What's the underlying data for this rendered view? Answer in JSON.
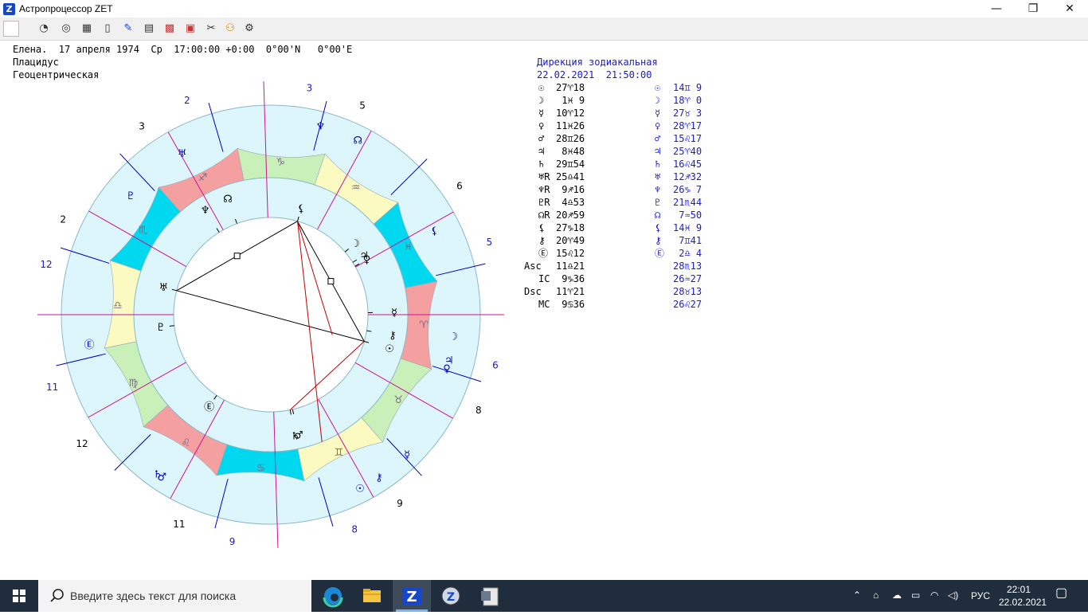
{
  "window": {
    "title": "Астропроцессор ZET",
    "minimize": "—",
    "restore": "❐",
    "close": "✕"
  },
  "header": {
    "line1": "Елена.  17 апреля 1974  Ср  17:00:00 +0:00  0°00'N   0°00'E",
    "line2": "Плацидус",
    "line3": "Геоцентрическая"
  },
  "direction": {
    "title": "Дирекция зодиакальная",
    "datetime": "22.02.2021  21:50:00",
    "rows": [
      {
        "l": "☉",
        "lv": "27♈18",
        "r": "☉",
        "rv": "14♊ 9"
      },
      {
        "l": "☽",
        "lv": " 1♓ 9",
        "r": "☽",
        "rv": "18♈ 0"
      },
      {
        "l": "☿",
        "lv": "10♈12",
        "r": "☿",
        "rv": "27♉ 3"
      },
      {
        "l": "♀",
        "lv": "11♓26",
        "r": "♀",
        "rv": "28♈17"
      },
      {
        "l": "♂",
        "lv": "28♊26",
        "r": "♂",
        "rv": "15♌17"
      },
      {
        "l": "♃",
        "lv": " 8♓48",
        "r": "♃",
        "rv": "25♈40"
      },
      {
        "l": "♄",
        "lv": "29♊54",
        "r": "♄",
        "rv": "16♌45"
      },
      {
        "l": "♅R",
        "lv": "25♎41",
        "r": "♅",
        "rv": "12♐32"
      },
      {
        "l": "♆R",
        "lv": " 9♐16",
        "r": "♆",
        "rv": "26♑ 7"
      },
      {
        "l": "♇R",
        "lv": " 4♎53",
        "r": "♇",
        "rv": "21♏44"
      },
      {
        "l": "☊R",
        "lv": "20♐59",
        "r": "☊",
        "rv": " 7♒50"
      },
      {
        "l": "⚸",
        "lv": "27♑18",
        "r": "⚸",
        "rv": "14♓ 9"
      },
      {
        "l": "⚷",
        "lv": "20♈49",
        "r": "⚷",
        "rv": " 7♊41"
      },
      {
        "l": "Ⓔ",
        "lv": "15♌12",
        "r": "Ⓔ",
        "rv": " 2♎ 4"
      },
      {
        "l": "Asc",
        "lv": "11♎21",
        "r": "",
        "rv": "28♏13"
      },
      {
        "l": "IC",
        "lv": " 9♑36",
        "r": "",
        "rv": "26♒27"
      },
      {
        "l": "Dsc",
        "lv": "11♈21",
        "r": "",
        "rv": "28♉13"
      },
      {
        "l": "MC",
        "lv": " 9♋36",
        "r": "",
        "rv": "26♌27"
      }
    ]
  },
  "chart_labels": {
    "asc": "Asc",
    "dsc": "Dsc",
    "mc": "MC",
    "ic": "IC",
    "dir_asc": "Asc",
    "dir_dsc": "Dsc",
    "dir_mc": "MC",
    "dir_ic": "IC"
  },
  "chart_data": {
    "type": "wheel",
    "signs": [
      "♈",
      "♉",
      "♊",
      "♋",
      "♌",
      "♍",
      "♎",
      "♏",
      "♐",
      "♑",
      "♒",
      "♓"
    ],
    "sign_colors": [
      "#f4a0a0",
      "#c8f0b8",
      "#fbfac0",
      "#00d8f0",
      "#f4a0a0",
      "#c8f0b8",
      "#fbfac0",
      "#00d8f0",
      "#f4a0a0",
      "#c8f0b8",
      "#fbfac0",
      "#00d8f0"
    ],
    "asc_longitude": 191.35,
    "natal_house_cusps": [
      191.35,
      221,
      252,
      279.6,
      310,
      342,
      11.35,
      41,
      72,
      99.6,
      130,
      162
    ],
    "natal_house_numbers": [
      "1",
      "2",
      "3",
      "4",
      "5",
      "6",
      "7",
      "8",
      "9",
      "10",
      "11",
      "12"
    ],
    "natal_planets": [
      {
        "glyph": "☉",
        "lon": 27.3
      },
      {
        "glyph": "☽",
        "lon": 331.15
      },
      {
        "glyph": "☿",
        "lon": 10.2
      },
      {
        "glyph": "♀",
        "lon": 341.43
      },
      {
        "glyph": "♂",
        "lon": 88.43
      },
      {
        "glyph": "♃",
        "lon": 338.8
      },
      {
        "glyph": "♄",
        "lon": 89.9
      },
      {
        "glyph": "♅",
        "lon": 205.68
      },
      {
        "glyph": "♆",
        "lon": 249.27
      },
      {
        "glyph": "♇",
        "lon": 184.88
      },
      {
        "glyph": "☊",
        "lon": 260.98
      },
      {
        "glyph": "⚸",
        "lon": 297.3
      },
      {
        "glyph": "⚷",
        "lon": 20.82
      },
      {
        "glyph": "Ⓔ",
        "lon": 135.2
      }
    ],
    "dir_house_cusps": [
      238.2,
      265,
      296,
      326.45,
      358,
      29,
      58.2,
      85,
      116,
      146.45,
      178,
      209
    ],
    "dir_house_numbers": [
      "1",
      "2",
      "3",
      "4",
      "5",
      "6",
      "7",
      "8",
      "9",
      "10",
      "11",
      "12"
    ],
    "dir_planets": [
      {
        "glyph": "☉",
        "lon": 74.15
      },
      {
        "glyph": "☽",
        "lon": 18.0
      },
      {
        "glyph": "☿",
        "lon": 57.05
      },
      {
        "glyph": "♀",
        "lon": 28.28
      },
      {
        "glyph": "♂",
        "lon": 135.28
      },
      {
        "glyph": "♃",
        "lon": 25.67
      },
      {
        "glyph": "♄",
        "lon": 136.75
      },
      {
        "glyph": "♅",
        "lon": 252.53
      },
      {
        "glyph": "♆",
        "lon": 296.12
      },
      {
        "glyph": "♇",
        "lon": 231.73
      },
      {
        "glyph": "☊",
        "lon": 307.83
      },
      {
        "glyph": "⚸",
        "lon": 344.15
      },
      {
        "glyph": "⚷",
        "lon": 67.68
      },
      {
        "glyph": "Ⓔ",
        "lon": 182.07
      }
    ]
  },
  "taskbar": {
    "search_placeholder": "Введите здесь текст для поиска",
    "lang": "РУС",
    "time": "22:01",
    "date": "22.02.2021"
  },
  "colors": {
    "blue_text": "#1a1ad0",
    "magenta": "#d0109a",
    "navy": "#0000c0",
    "aspect_red": "#c00000"
  }
}
